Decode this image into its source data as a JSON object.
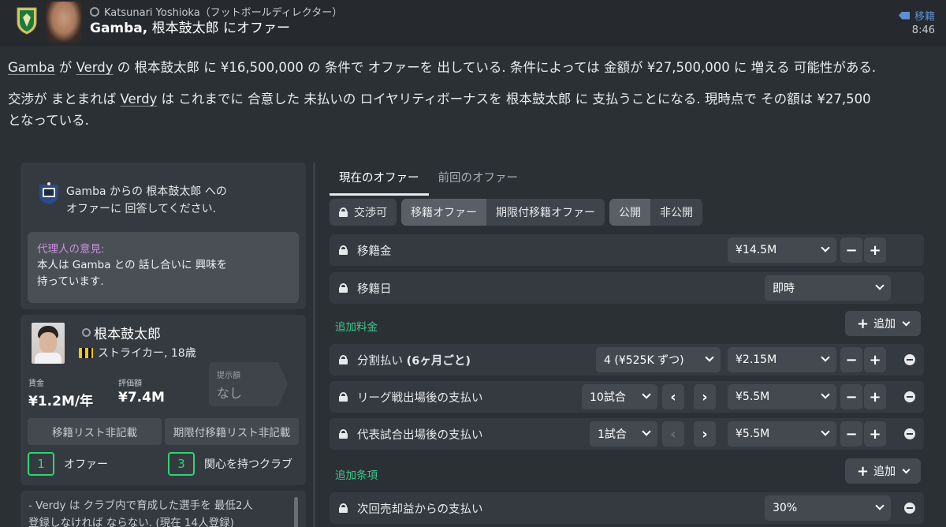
{
  "header": {
    "manager_name": "Katsunari Yoshioka（フットボールディレクター）",
    "title_bold": "Gamba,",
    "title_rest": " 根本鼓太郎 にオファー",
    "transfer_tag": "移籍",
    "time": "8:46"
  },
  "body": {
    "p1": {
      "s1": "Gamba",
      "s2": " が ",
      "s3": "Verdy",
      "s4": " の 根本鼓太郎 に ¥16,500,000 の 条件で オファーを 出している. 条件によっては 金額が ¥27,500,000 に 増える 可能性がある."
    },
    "p2": {
      "s1": "交渉が まとまれば ",
      "s2": "Verdy",
      "s3": " は これまでに 合意した 未払いの ロイヤリティボーナスを 根本鼓太郎 に 支払うことになる. 現時点で その額は ¥27,500",
      "s4": "となっている."
    }
  },
  "offer_card": {
    "line1": "Gamba からの 根本鼓太郎 への",
    "line2": "オファーに 回答してください.",
    "agent_title": "代理人の意見:",
    "agent_line1": "本人は Gamba との 話し合いに 興味を",
    "agent_line2": "持っています."
  },
  "player": {
    "name": "根本鼓太郎",
    "position": "ストライカー, 18歳",
    "wage_label": "賃金",
    "wage_value": "¥1.2M/年",
    "value_label": "評価額",
    "value_value": "¥7.4M",
    "proposal_label": "提示額",
    "proposal_value": "なし",
    "transfer_list_btn": "移籍リスト非記載",
    "loan_list_btn": "期限付移籍リスト非記載",
    "offers_count": "1",
    "offers_label": "オファー",
    "interest_count": "3",
    "interest_label": "関心を持つクラブ"
  },
  "notes": {
    "line1": "- Verdy は クラブ内で育成した選手を 最低2人",
    "line2": "登録しなければ ならない. (現在 14人登録)"
  },
  "tabs": {
    "current": "現在のオファー",
    "previous": "前回のオファー"
  },
  "options": {
    "negotiable": "交渉可",
    "transfer_offer": "移籍オファー",
    "loan_offer": "期限付移籍オファー",
    "public": "公開",
    "private": "非公開"
  },
  "rows": {
    "fee_label": "移籍金",
    "fee_value": "¥14.5M",
    "date_label": "移籍日",
    "date_value": "即時",
    "installments_label_a": "分割払い ",
    "installments_label_b": "(6ヶ月ごと)",
    "installments_count": "4 (¥525K ずつ)",
    "installments_value": "¥2.15M",
    "league_label": "リーグ戦出場後の支払い",
    "league_count": "10試合",
    "league_value": "¥5.5M",
    "intl_label": "代表試合出場後の支払い",
    "intl_count": "1試合",
    "intl_value": "¥5.5M",
    "resale_label": "次回売却益からの支払い",
    "resale_value": "30%"
  },
  "sections": {
    "add_fees": "追加料金",
    "add_clauses": "追加条項",
    "add_button": "追加"
  },
  "icons": {
    "lock": "lock-icon",
    "plus": "+",
    "minus": "−",
    "left": "‹",
    "right": "›"
  },
  "colors": {
    "accent_green": "#2ed573",
    "section_green": "#3ec98a",
    "agent_purple": "#c98fe0",
    "transfer_blue": "#5d8fd6"
  }
}
